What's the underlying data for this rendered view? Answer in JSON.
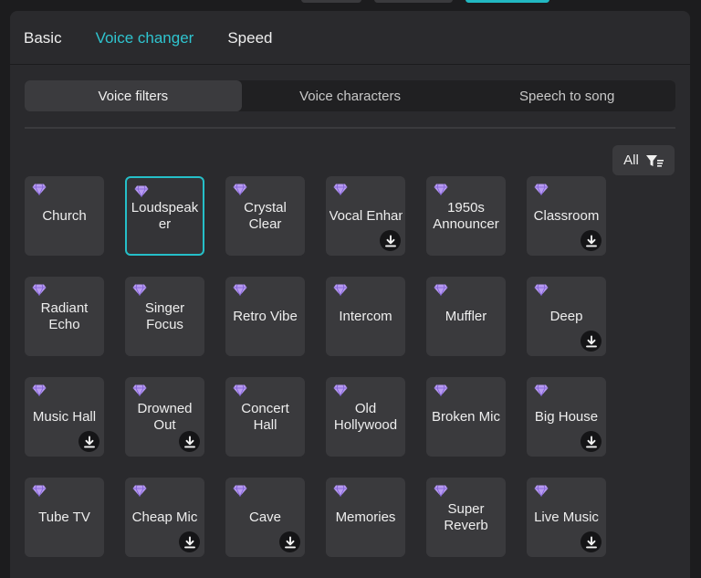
{
  "main_tabs": [
    {
      "label": "Basic"
    },
    {
      "label": "Voice changer"
    },
    {
      "label": "Speed"
    }
  ],
  "main_tabs_active": 1,
  "sub_tabs": [
    {
      "label": "Voice filters"
    },
    {
      "label": "Voice characters"
    },
    {
      "label": "Speech to song"
    }
  ],
  "sub_tabs_active": 0,
  "filter": {
    "label": "All",
    "icon": "filter-icon"
  },
  "colors": {
    "accent": "#2fc4cf",
    "premium_gem": "#b89bf2"
  },
  "presets": [
    {
      "name": "Church",
      "premium": true,
      "download": false,
      "selected": false
    },
    {
      "name": "Loudspeaker",
      "premium": true,
      "download": false,
      "selected": true
    },
    {
      "name": "Crystal Clear",
      "premium": true,
      "download": false,
      "selected": false
    },
    {
      "name": "Vocal Enhance...",
      "premium": true,
      "download": true,
      "selected": false
    },
    {
      "name": "1950s Announcer",
      "premium": true,
      "download": false,
      "selected": false
    },
    {
      "name": "Classroom",
      "premium": true,
      "download": true,
      "selected": false
    },
    {
      "name": "Radiant Echo",
      "premium": true,
      "download": false,
      "selected": false
    },
    {
      "name": "Singer Focus",
      "premium": true,
      "download": false,
      "selected": false
    },
    {
      "name": "Retro Vibe",
      "premium": true,
      "download": false,
      "selected": false
    },
    {
      "name": "Intercom",
      "premium": true,
      "download": false,
      "selected": false
    },
    {
      "name": "Muffler",
      "premium": true,
      "download": false,
      "selected": false
    },
    {
      "name": "Deep",
      "premium": true,
      "download": true,
      "selected": false
    },
    {
      "name": "Music Hall",
      "premium": true,
      "download": true,
      "selected": false
    },
    {
      "name": "Drowned Out",
      "premium": true,
      "download": true,
      "selected": false
    },
    {
      "name": "Concert Hall",
      "premium": true,
      "download": false,
      "selected": false
    },
    {
      "name": "Old Hollywood",
      "premium": true,
      "download": false,
      "selected": false
    },
    {
      "name": "Broken Mic",
      "premium": true,
      "download": false,
      "selected": false
    },
    {
      "name": "Big House",
      "premium": true,
      "download": true,
      "selected": false
    },
    {
      "name": "Tube TV",
      "premium": true,
      "download": false,
      "selected": false
    },
    {
      "name": "Cheap Mic",
      "premium": true,
      "download": true,
      "selected": false
    },
    {
      "name": "Cave",
      "premium": true,
      "download": true,
      "selected": false
    },
    {
      "name": "Memories",
      "premium": true,
      "download": false,
      "selected": false
    },
    {
      "name": "Super Reverb",
      "premium": true,
      "download": false,
      "selected": false
    },
    {
      "name": "Live Music",
      "premium": true,
      "download": true,
      "selected": false
    }
  ]
}
